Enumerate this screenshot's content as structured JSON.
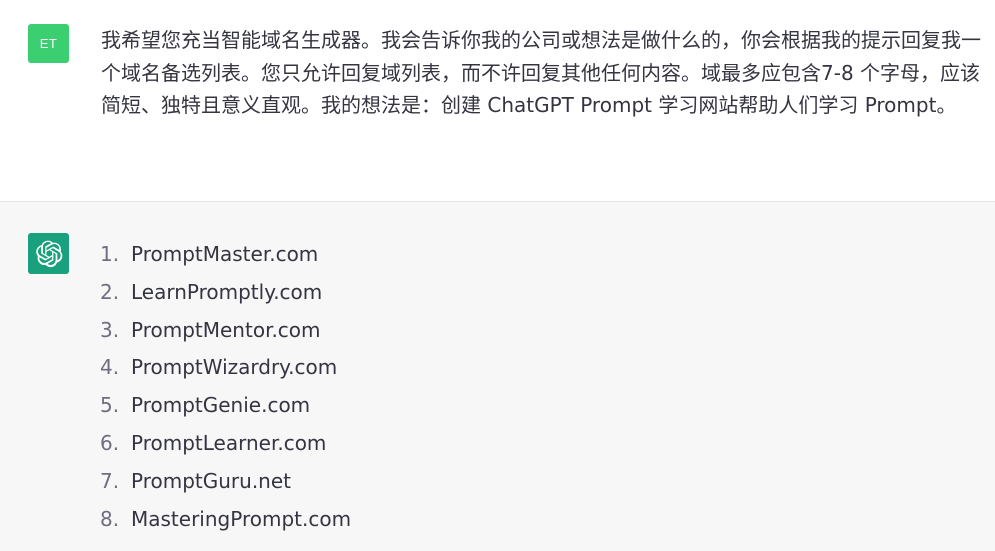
{
  "user": {
    "avatar_initials": "ET",
    "message": "我希望您充当智能域名生成器。我会告诉你我的公司或想法是做什么的，你会根据我的提示回复我一个域名备选列表。您只允许回复域列表，而不许回复其他任何内容。域最多应包含7-8 个字母，应该简短、独特且意义直观。我的想法是：创建 ChatGPT Prompt 学习网站帮助人们学习 Prompt。"
  },
  "assistant": {
    "avatar_icon": "openai-logo-icon",
    "items": [
      {
        "num": "1.",
        "text": "PromptMaster.com"
      },
      {
        "num": "2.",
        "text": "LearnPromptly.com"
      },
      {
        "num": "3.",
        "text": "PromptMentor.com"
      },
      {
        "num": "4.",
        "text": "PromptWizardry.com"
      },
      {
        "num": "5.",
        "text": "PromptGenie.com"
      },
      {
        "num": "6.",
        "text": "PromptLearner.com"
      },
      {
        "num": "7.",
        "text": "PromptGuru.net"
      },
      {
        "num": "8.",
        "text": "MasteringPrompt.com"
      }
    ]
  },
  "colors": {
    "user_avatar_bg": "#3bcf72",
    "assistant_avatar_bg": "#19a07c",
    "assistant_block_bg": "#f7f7f8",
    "text": "#343541"
  }
}
